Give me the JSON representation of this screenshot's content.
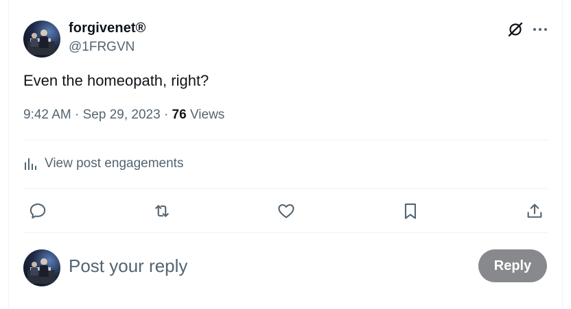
{
  "post": {
    "author": {
      "display_name": "forgivenet®",
      "handle": "@1FRGVN"
    },
    "text": "Even the homeopath, right?",
    "time": "9:42 AM",
    "separator": "·",
    "date": "Sep 29, 2023",
    "views_count": "76",
    "views_label": "Views"
  },
  "engagements": {
    "label": "View post engagements",
    "icon": "bar-chart-icon"
  },
  "actions": [
    {
      "name": "reply-action",
      "icon": "speech-bubble-icon"
    },
    {
      "name": "repost-action",
      "icon": "repost-arrows-icon"
    },
    {
      "name": "like-action",
      "icon": "heart-icon"
    },
    {
      "name": "bookmark-action",
      "icon": "bookmark-icon"
    },
    {
      "name": "share-action",
      "icon": "upload-share-icon"
    }
  ],
  "reply_box": {
    "placeholder": "Post your reply",
    "button_label": "Reply"
  },
  "colors": {
    "text_primary": "#0f1419",
    "text_secondary": "#536471",
    "divider": "#eff3f4",
    "reply_button_disabled": "#87898c"
  }
}
